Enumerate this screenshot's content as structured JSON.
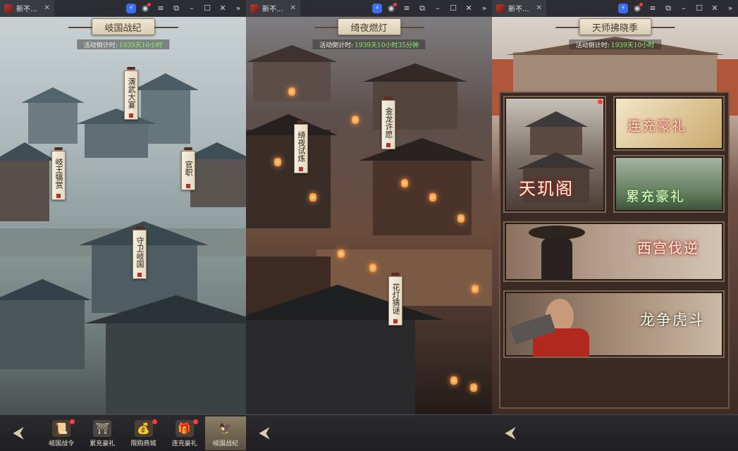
{
  "panels": [
    {
      "tab_title": "新不...",
      "title": "岐国战纪",
      "countdown_label": "活动倒计时:",
      "countdown_value": "1939天10小时",
      "signs": [
        "演武大宴",
        "岐王犒赏",
        "官职",
        "守卫岐国"
      ],
      "nav": [
        {
          "label": "岐国战令",
          "badge": true
        },
        {
          "label": "累充豪礼",
          "badge": false
        },
        {
          "label": "限购商城",
          "badge": true
        },
        {
          "label": "连充豪礼",
          "badge": true
        },
        {
          "label": "岐国战纪",
          "badge": false,
          "active": true
        }
      ]
    },
    {
      "tab_title": "新不...",
      "title": "绮夜燃灯",
      "countdown_label": "活动倒计时:",
      "countdown_value": "1939天10小时35分钟",
      "signs": [
        "金龙许愿",
        "绮夜试炼",
        "花灯猜谜"
      ]
    },
    {
      "tab_title": "新不...",
      "title": "天师拂晓季",
      "countdown_label": "活动倒计时:",
      "countdown_value": "1939天10小时",
      "cards": [
        "天玑阁",
        "连充豪礼",
        "累充豪礼",
        "西宫伐逆",
        "龙争虎斗"
      ]
    }
  ],
  "colors": {
    "countdown_green": "#8cf56a",
    "badge_red": "#ff3b3b",
    "banner_bg": "#efe7d6"
  },
  "icons": {
    "back": "back-arrow-icon",
    "tab_close": "close-icon",
    "toolbar": [
      "extension-icon",
      "account-icon",
      "menu-icon",
      "restore-icon",
      "minimize-icon",
      "maximize-icon",
      "close-icon",
      "chevron-right-icon"
    ]
  }
}
